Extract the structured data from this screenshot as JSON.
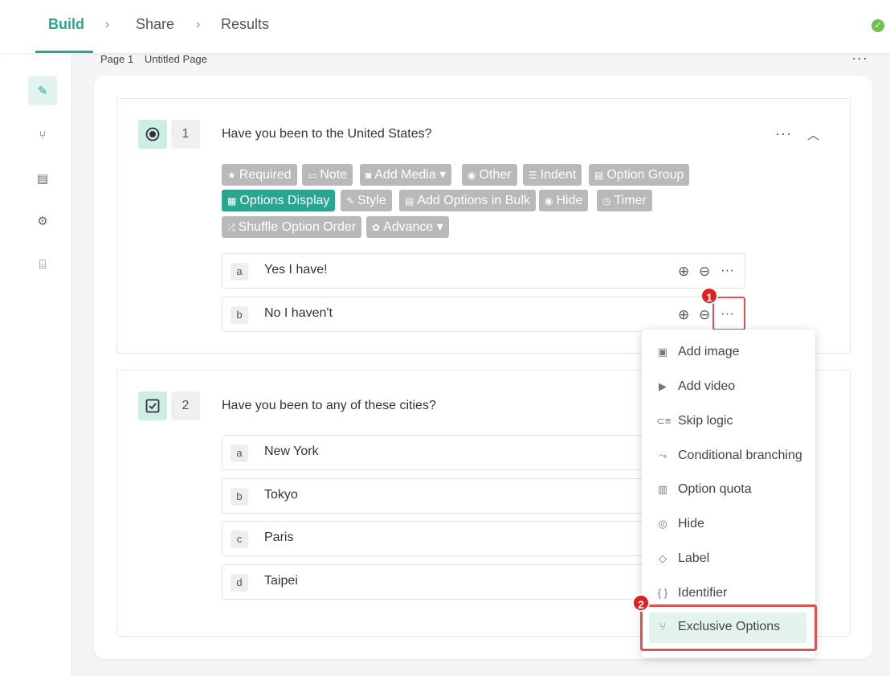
{
  "nav": {
    "tabs": [
      "Build",
      "Share",
      "Results"
    ],
    "chevron": "›"
  },
  "page": {
    "number": "Page 1",
    "name": "Untitled Page",
    "menu": "···"
  },
  "question1": {
    "number": "1",
    "title": "Have you been to the United States?",
    "toolbar": [
      {
        "label": "Required",
        "icon": "★"
      },
      {
        "label": "Note",
        "icon": "▭"
      },
      {
        "label": "Add Media",
        "icon": "◙",
        "caret": "▾"
      },
      {
        "label": "Other",
        "icon": "◉"
      },
      {
        "label": "Indent",
        "icon": "☰"
      },
      {
        "label": "Option Group",
        "icon": "▤"
      },
      {
        "label": "Options Display",
        "icon": "▦"
      },
      {
        "label": "Style",
        "icon": "✎"
      },
      {
        "label": "Add Options in Bulk",
        "icon": "▤"
      },
      {
        "label": "Hide",
        "icon": "◉"
      },
      {
        "label": "Timer",
        "icon": "◷"
      },
      {
        "label": "Shuffle Option Order",
        "icon": "⤮"
      },
      {
        "label": "Advance",
        "icon": "✿",
        "caret": "▾"
      }
    ],
    "options": [
      {
        "letter": "a",
        "text": "Yes I have!"
      },
      {
        "letter": "b",
        "text": "No I haven't"
      }
    ]
  },
  "question2": {
    "number": "2",
    "title": "Have you been to any of these cities?",
    "options": [
      {
        "letter": "a",
        "text": "New York"
      },
      {
        "letter": "b",
        "text": "Tokyo"
      },
      {
        "letter": "c",
        "text": "Paris"
      },
      {
        "letter": "d",
        "text": "Taipei"
      }
    ]
  },
  "option_actions": {
    "add": "⊕",
    "remove": "⊖",
    "more": "···"
  },
  "menu": {
    "items": [
      {
        "label": "Add image",
        "icon": "▣"
      },
      {
        "label": "Add video",
        "icon": "▶"
      },
      {
        "label": "Skip logic",
        "icon": "⊂≡"
      },
      {
        "label": "Conditional branching",
        "icon": "⤳"
      },
      {
        "label": "Option quota",
        "icon": "▥"
      },
      {
        "label": "Hide",
        "icon": "◎"
      },
      {
        "label": "Label",
        "icon": "◇"
      },
      {
        "label": "Identifier",
        "icon": "{ }"
      },
      {
        "label": "Exclusive Options",
        "icon": "⑂"
      }
    ]
  },
  "badges": [
    "1",
    "2"
  ],
  "colors": {
    "accent": "#2aa58f",
    "chip": "#b9b9b9",
    "highlight": "#e05252"
  }
}
